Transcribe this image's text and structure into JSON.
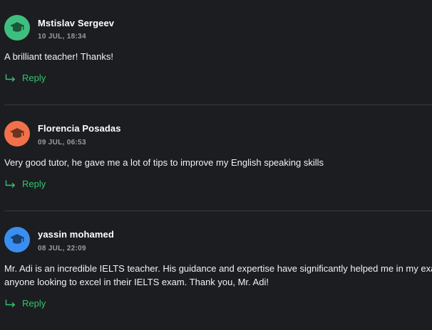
{
  "colors": {
    "background": "#1c1d21",
    "accent_green": "#33c36b",
    "divider": "#3a3b40"
  },
  "comments": [
    {
      "author": "Mstislav Sergeev",
      "timestamp": "10 JUL, 18:34",
      "text_lines": [
        "A brilliant teacher! Thanks!"
      ],
      "reply_label": "Reply",
      "avatar_color": "#3fbf7f",
      "avatar_icon": "graduation-cap-icon"
    },
    {
      "author": "Florencia Posadas",
      "timestamp": "09 JUL, 06:53",
      "text_lines": [
        "Very good tutor, he gave me a lot of tips to improve my English speaking skills"
      ],
      "reply_label": "Reply",
      "avatar_color": "#f0714a",
      "avatar_icon": "graduation-cap-icon"
    },
    {
      "author": "yassin mohamed",
      "timestamp": "08 JUL, 22:09",
      "text_lines": [
        "Mr. Adi is an incredible IELTS teacher. His guidance and expertise have significantly helped me in my exam",
        "anyone looking to excel in their IELTS exam. Thank you, Mr. Adi!"
      ],
      "reply_label": "Reply",
      "avatar_color": "#3a8ef0",
      "avatar_icon": "graduation-cap-icon"
    }
  ]
}
